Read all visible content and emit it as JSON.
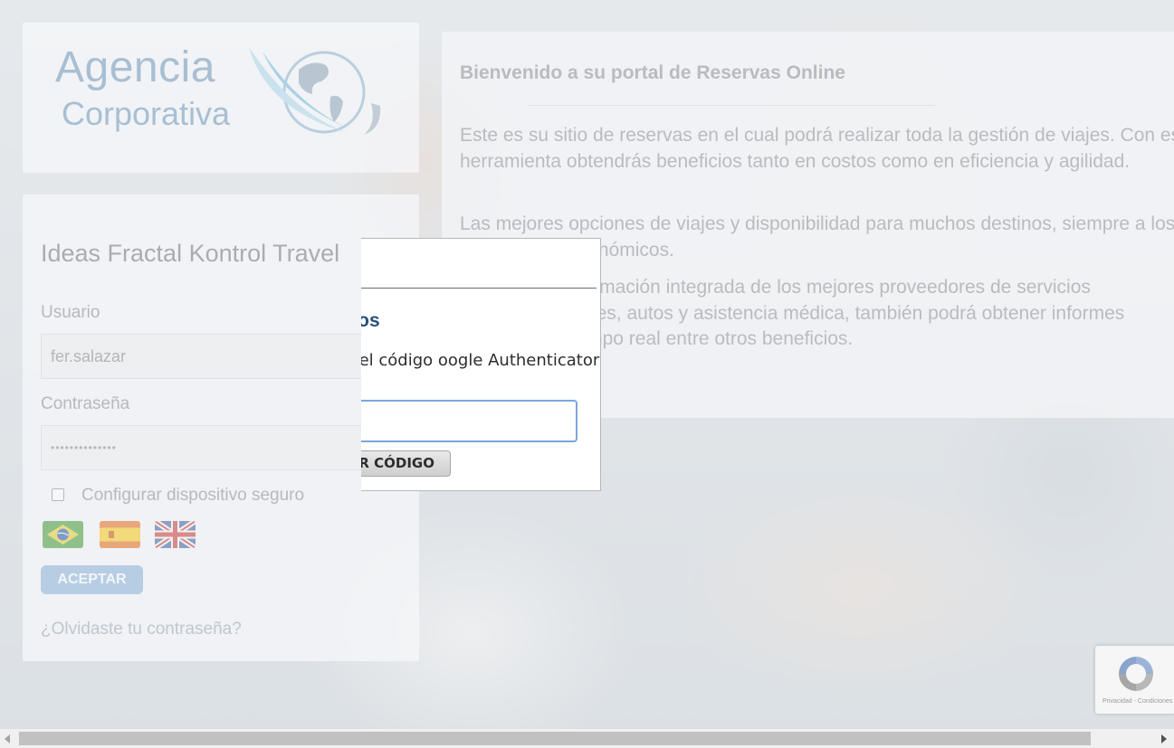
{
  "logo": {
    "line1": "Agencia",
    "line2": "Corporativa",
    "icon": "globe-swoosh-icon"
  },
  "login": {
    "title": "Ideas Fractal Kontrol Travel",
    "username_label": "Usuario",
    "username_value": "fer.salazar",
    "password_label": "Contraseña",
    "password_value": "••••••••••••••",
    "remember_label": "Configurar dispositivo seguro",
    "remember_checked": false,
    "languages": [
      "flag-brazil-icon",
      "flag-spain-icon",
      "flag-uk-icon"
    ],
    "accept_label": "ACEPTAR",
    "forgot_label": "¿Olvidaste tu contraseña?"
  },
  "welcome": {
    "title": "Bienvenido a su portal de Reservas Online",
    "p1": "Este es su sitio de reservas en el cual podrá realizar toda la gestión de viajes. Con esta herramienta obtendrás beneficios tanto en costos como en eficiencia y agilidad.",
    "p2": "Las mejores opciones de viajes y disponibilidad para muchos destinos, siempre a los precios más económicos.",
    "p3": "Con toda la información integrada de los mejores proveedores de servicios aéreos, de hoteles, autos y asistencia médica, también podrá obtener informes de viajes en tiempo real entre otros beneficios."
  },
  "modal": {
    "title": "pasos",
    "text": "oceso ingrese el código oogle Authenticator:",
    "input_value": "",
    "button_label": "R CÓDIGO"
  },
  "recaptcha": {
    "footer": "Privacidad - Condiciones",
    "icon": "recaptcha-icon"
  },
  "colors": {
    "accent": "#2b4f79",
    "button_disabled": "#b7cde3",
    "focus_border": "#7aa7dc"
  }
}
